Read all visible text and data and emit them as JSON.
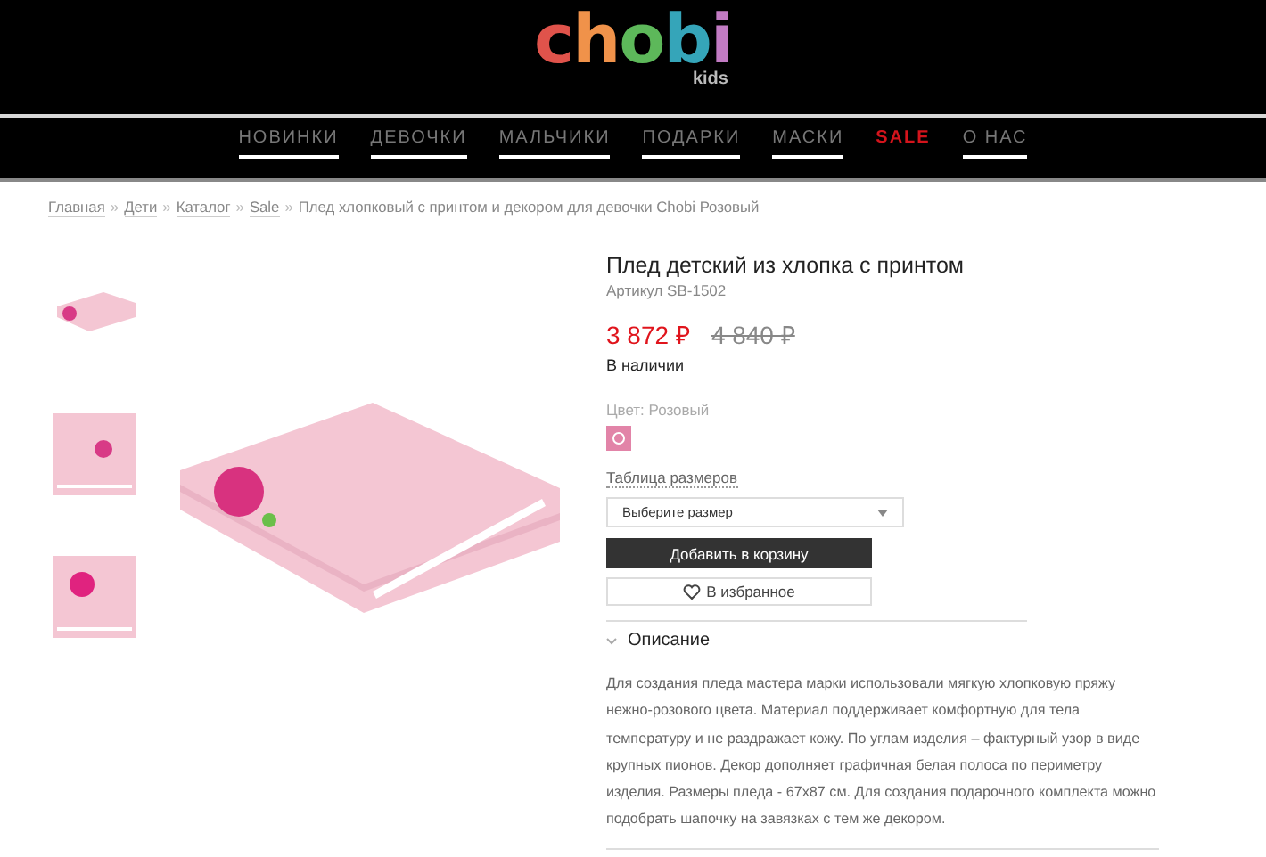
{
  "logo": {
    "letters": [
      {
        "text": "c",
        "color": "#e0534b"
      },
      {
        "text": "h",
        "color": "#f0924a"
      },
      {
        "text": "o",
        "color": "#5db85a"
      },
      {
        "text": "b",
        "color": "#35a5b9"
      },
      {
        "text": "i",
        "color": "#c27bc3"
      }
    ],
    "subtitle": "kids"
  },
  "nav": [
    {
      "label": "НОВИНКИ",
      "kind": "normal"
    },
    {
      "label": "ДЕВОЧКИ",
      "kind": "normal"
    },
    {
      "label": "МАЛЬЧИКИ",
      "kind": "normal"
    },
    {
      "label": "ПОДАРКИ",
      "kind": "normal"
    },
    {
      "label": "МАСКИ",
      "kind": "normal"
    },
    {
      "label": "SALE",
      "kind": "sale"
    },
    {
      "label": "О НАС",
      "kind": "normal"
    }
  ],
  "breadcrumbs": {
    "links": [
      "Главная",
      "Дети",
      "Каталог",
      "Sale"
    ],
    "separator": "»",
    "current": "Плед хлопковый с принтом и декором для девочки Chobi Розовый"
  },
  "product": {
    "title": "Плед детский из хлопка с принтом",
    "sku": "Артикул SB-1502",
    "price": "3 872 ₽",
    "old_price": "4 840 ₽",
    "availability": "В наличии",
    "color_label": "Цвет: Розовый",
    "swatches": [
      {
        "color": "#e284a8",
        "selected": true
      }
    ],
    "size_table_link": "Таблица размеров",
    "size_select": {
      "placeholder": "Выберите размер"
    },
    "add_to_cart": "Добавить в корзину",
    "favorite": "В избранное"
  },
  "description": {
    "heading": "Описание",
    "expanded": true,
    "text": "Для создания пледа мастера марки использовали мягкую хлопковую пряжу нежно-розового цвета. Материал поддерживает комфортную для тела температуру и не раздражает кожу. По углам изделия – фактурный узор в виде крупных пионов. Декор дополняет графичная белая полоса по периметру изделия. Размеры пледа - 67х87 см. Для создания подарочного комплекта можно подобрать шапочку на завязках с тем же декором."
  }
}
